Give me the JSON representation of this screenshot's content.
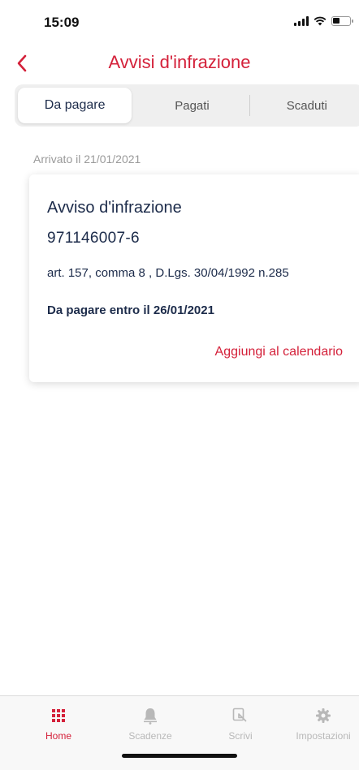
{
  "status": {
    "time": "15:09"
  },
  "header": {
    "title": "Avvisi d'infrazione"
  },
  "tabs": [
    {
      "label": "Da pagare"
    },
    {
      "label": "Pagati"
    },
    {
      "label": "Scaduti"
    }
  ],
  "list": {
    "arrived": "Arrivato il 21/01/2021",
    "card": {
      "title": "Avviso d'infrazione",
      "number": "971146007-6",
      "article": "art. 157, comma 8 , D.Lgs. 30/04/1992 n.285",
      "due": "Da pagare entro il 26/01/2021",
      "calendar_link": "Aggiungi al calendario"
    }
  },
  "bottom_nav": [
    {
      "label": "Home",
      "icon": "grid-icon"
    },
    {
      "label": "Scadenze",
      "icon": "bell-icon"
    },
    {
      "label": "Scrivi",
      "icon": "compose-icon"
    },
    {
      "label": "Impostazioni",
      "icon": "gear-icon"
    }
  ],
  "colors": {
    "accent": "#d4213a",
    "text": "#1c2b4a",
    "inactive": "#b8b8b8"
  }
}
